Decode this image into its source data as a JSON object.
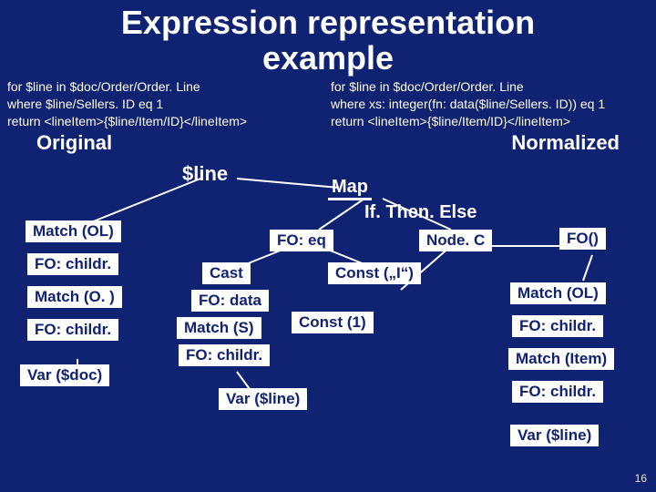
{
  "title_line1": "Expression representation",
  "title_line2": "example",
  "original": {
    "l1": "for $line in $doc/Order/Order. Line",
    "l2": "where $line/Sellers. ID eq 1",
    "l3": "return <lineItem>{$line/Item/ID}</lineItem>"
  },
  "normalized": {
    "l1": "for $line in $doc/Order/Order. Line",
    "l2": "where xs: integer(fn: data($line/Sellers. ID)) eq 1",
    "l3": "return <lineItem>{$line/Item/ID}</lineItem>"
  },
  "label_original": "Original",
  "label_normalized": "Normalized",
  "label_line": "$line",
  "label_map": "Map",
  "label_ite": "If. Then. Else",
  "left": {
    "match_ol": "Match (OL)",
    "fo_childr1": "FO: childr.",
    "match_o": "Match (O. )",
    "fo_childr2": "FO: childr.",
    "var_doc": "Var ($doc)"
  },
  "mid": {
    "fo_eq": "FO: eq",
    "cast": "Cast",
    "fo_data": "FO: data",
    "match_s": "Match (S)",
    "fo_childr": "FO: childr.",
    "var_line": "Var ($line)",
    "const_i": "Const („I“)",
    "const_1": "Const (1)"
  },
  "right": {
    "nodec": "Node. C",
    "fo_paren": "FO()",
    "match_ol": "Match (OL)",
    "fo_childr1": "FO: childr.",
    "match_item": "Match (Item)",
    "fo_childr2": "FO: childr.",
    "var_line": "Var ($line)"
  },
  "page": "16"
}
